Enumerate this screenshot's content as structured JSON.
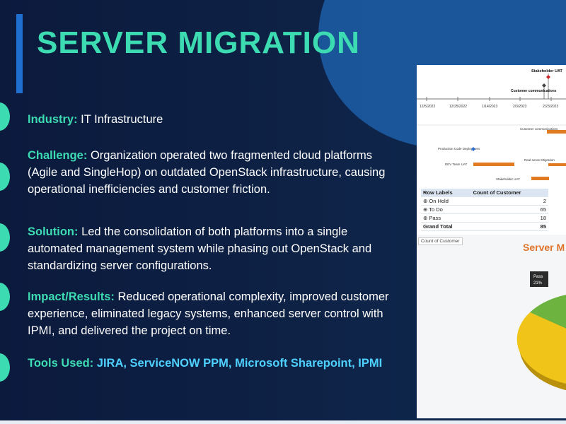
{
  "slide": {
    "title": "SERVER MIGRATION",
    "sections": {
      "industry": {
        "label": "Industry:",
        "text": " IT Infrastructure"
      },
      "challenge": {
        "label": "Challenge:",
        "text": " Organization operated two fragmented cloud platforms (Agile and SingleHop) on outdated OpenStack infrastructure, causing operational inefficiencies and customer friction."
      },
      "solution": {
        "label": "Solution:",
        "text": " Led the consolidation of both platforms into a single automated management system while phasing out OpenStack and standardizing server configurations."
      },
      "impact": {
        "label": "Impact/Results:",
        "text": "  Reduced operational complexity, improved customer experience, eliminated legacy systems, enhanced server control with IPMI, and delivered the project on time."
      },
      "tools": {
        "label": "Tools Used:",
        "text": "  JIRA, ServiceNOW PPM, Microsoft Sharepoint, IPMI"
      }
    }
  },
  "gantt": {
    "milestone_labels": [
      "Stakeholder UAT",
      "Customer communications"
    ],
    "dates": [
      "12/5/2022",
      "12/25/2022",
      "1/14/2023",
      "2/3/2023",
      "2/23/2023"
    ],
    "tasks": [
      "Customer communications",
      "Production Code Deployment",
      "Real server Migration",
      "DEV Team UAT",
      "Stakeholder UAT"
    ]
  },
  "pivot": {
    "headers": [
      "Row Labels",
      "Count of Customer"
    ],
    "rows": [
      {
        "label": "On Hold",
        "value": "2"
      },
      {
        "label": "To Do",
        "value": "65"
      },
      {
        "label": "Pass",
        "value": "18"
      }
    ],
    "total": {
      "label": "Grand Total",
      "value": "85"
    }
  },
  "chart_data": {
    "type": "pie",
    "title": "Server M",
    "tag": "Count of Customer",
    "slices": [
      {
        "label": "Pass",
        "value_label": "21%",
        "color": "#6db33f"
      },
      {
        "label": "",
        "value_label": "",
        "color": "#f0c419"
      }
    ]
  },
  "colors": {
    "accent": "#3ddbb2",
    "tools": "#4fd1ff",
    "background": "#0c1a3b",
    "bar": "#1f6fd1"
  }
}
